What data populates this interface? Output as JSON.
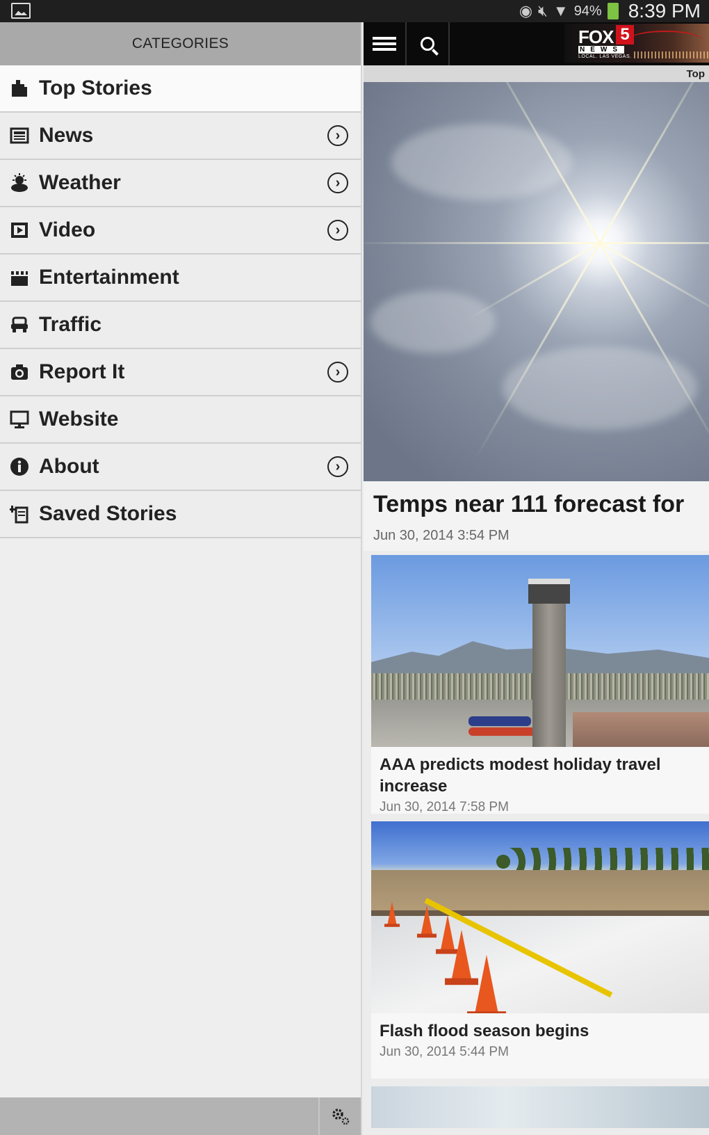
{
  "status_bar": {
    "battery_pct": "94%",
    "time": "8:39 PM",
    "icons": [
      "image-icon",
      "eye-icon",
      "mute-icon",
      "wifi-icon",
      "battery-icon"
    ]
  },
  "drawer": {
    "header": "CATEGORIES",
    "items": [
      {
        "label": "Top Stories",
        "icon": "top-stories-icon",
        "has_arrow": false,
        "selected": true
      },
      {
        "label": "News",
        "icon": "news-icon",
        "has_arrow": true,
        "selected": false
      },
      {
        "label": "Weather",
        "icon": "weather-icon",
        "has_arrow": true,
        "selected": false
      },
      {
        "label": "Video",
        "icon": "video-icon",
        "has_arrow": true,
        "selected": false
      },
      {
        "label": "Entertainment",
        "icon": "entertainment-icon",
        "has_arrow": false,
        "selected": false
      },
      {
        "label": "Traffic",
        "icon": "car-icon",
        "has_arrow": false,
        "selected": false
      },
      {
        "label": "Report It",
        "icon": "camera-icon",
        "has_arrow": true,
        "selected": false
      },
      {
        "label": "Website",
        "icon": "monitor-icon",
        "has_arrow": false,
        "selected": false
      },
      {
        "label": "About",
        "icon": "info-icon",
        "has_arrow": true,
        "selected": false
      },
      {
        "label": "Saved Stories",
        "icon": "saved-stories-icon",
        "has_arrow": false,
        "selected": false
      }
    ],
    "footer_icon": "settings-gears-icon"
  },
  "toolbar": {
    "menu_icon": "hamburger-icon",
    "search_icon": "search-icon",
    "logo": {
      "fox": "FOX",
      "number": "5",
      "news": "NEWS",
      "tagline": "LOCAL. LAS VEGAS."
    }
  },
  "tab": {
    "label": "Top"
  },
  "lead_story": {
    "title": "Temps near 111 forecast for",
    "date": "Jun 30, 2014 3:54 PM"
  },
  "stories": [
    {
      "title": "AAA predicts modest holiday travel increase",
      "date": "Jun 30, 2014 7:58 PM"
    },
    {
      "title": "Flash flood season begins",
      "date": "Jun 30, 2014 5:44 PM"
    }
  ],
  "colors": {
    "status_bar_bg": "#1f1f1f",
    "drawer_header_bg": "#a9a9a9",
    "toolbar_bg": "#0a0a0a",
    "battery": "#7dc242",
    "fox_red": "#d0121b"
  }
}
